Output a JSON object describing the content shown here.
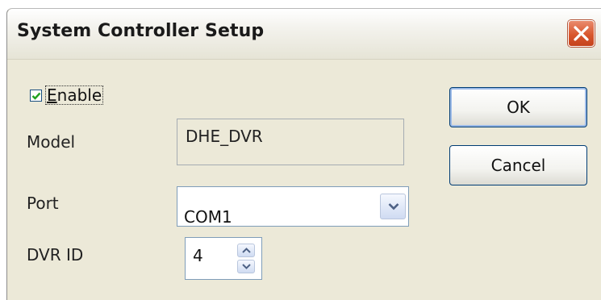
{
  "window": {
    "title": "System Controller Setup",
    "close_glyph": "close-icon"
  },
  "enable": {
    "checked": true,
    "label_first": "E",
    "label_rest": "nable"
  },
  "model": {
    "label": "Model",
    "value": "DHE_DVR"
  },
  "port": {
    "label": "Port",
    "value": "COM1"
  },
  "dvr_id": {
    "label": "DVR ID",
    "value": "4"
  },
  "buttons": {
    "ok": "OK",
    "cancel": "Cancel"
  },
  "colors": {
    "dialog_bg": "#ece9d8",
    "close_red": "#d9572e",
    "focus_blue": "#9dbbe8"
  }
}
